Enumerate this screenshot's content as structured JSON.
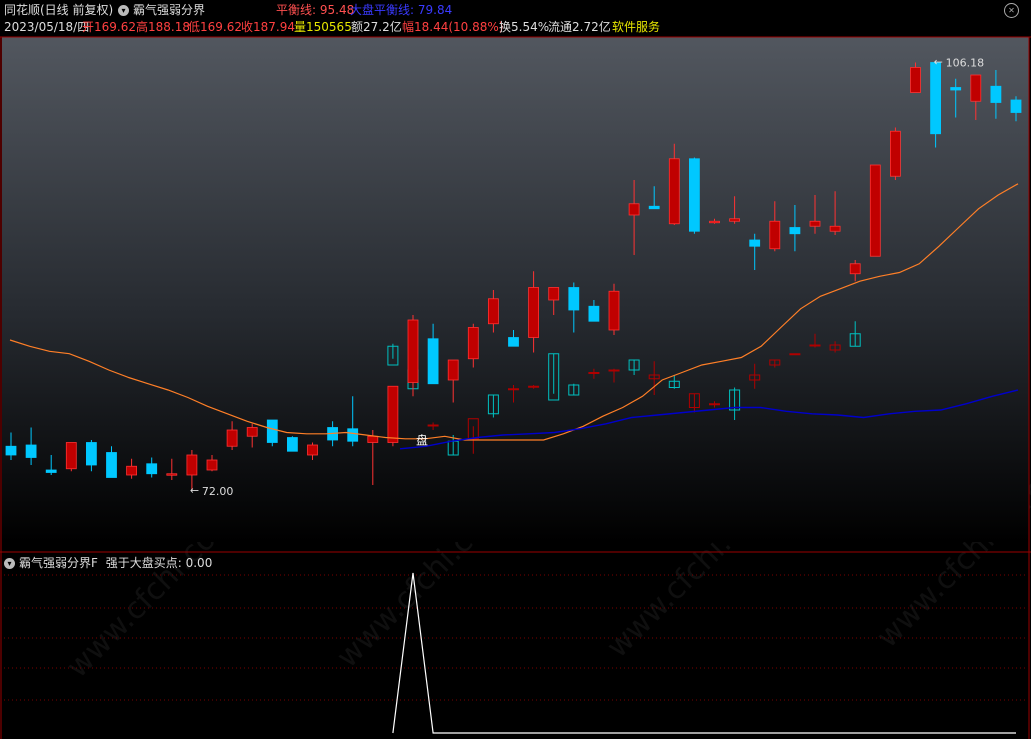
{
  "app": {
    "name": "同花顺(日线 前复权)",
    "indicator": "霸气强弱分界",
    "balance_label": "平衡线:",
    "balance_value": "95.48",
    "benchmark_label": "大盘平衡线:",
    "benchmark_value": "79.84"
  },
  "info": {
    "date": "2023/05/18/四",
    "open_label": "开",
    "open": "169.62",
    "high_label": "高",
    "high": "188.18",
    "low_label": "低",
    "low": "169.62",
    "close_label": "收",
    "close": "187.94",
    "vol_label": "量",
    "vol": "150565",
    "amount_label": "额",
    "amount": "27.2亿",
    "change_label": "幅",
    "change": "18.44(10.88%)",
    "turnover_label": "换",
    "turnover": "5.54%",
    "float_label": "流通",
    "float_cap": "2.72亿",
    "sector": "软件服务"
  },
  "colors": {
    "up": "#ff3232",
    "up_fill": "#c00000",
    "down": "#00c8ff",
    "ma_line": "#ff7f27",
    "index_line": "#0000cc",
    "index_up": "#b00000",
    "index_down": "#00c0c0",
    "border": "#9b0000"
  },
  "main_chart": {
    "max_label": "106.18",
    "min_label": "72.00",
    "marker": "盘"
  },
  "sub_chart": {
    "title": "霸气强弱分界F",
    "series_label": "强于大盘买点:",
    "series_value": "0.00"
  },
  "watermark": "www.cfchi.com",
  "chart_data": {
    "type": "candlestick",
    "y_range": [
      68,
      108
    ],
    "candles": [
      {
        "o": 75.5,
        "h": 76.6,
        "l": 74.4,
        "c": 74.8
      },
      {
        "o": 75.6,
        "h": 77.0,
        "l": 74.0,
        "c": 74.6
      },
      {
        "o": 73.6,
        "h": 74.8,
        "l": 73.2,
        "c": 73.4
      },
      {
        "o": 73.7,
        "h": 75.8,
        "l": 73.5,
        "c": 75.8
      },
      {
        "o": 75.8,
        "h": 76.0,
        "l": 73.5,
        "c": 74.0
      },
      {
        "o": 75.0,
        "h": 75.5,
        "l": 73.0,
        "c": 73.0
      },
      {
        "o": 73.2,
        "h": 74.5,
        "l": 72.9,
        "c": 73.9
      },
      {
        "o": 74.1,
        "h": 74.6,
        "l": 73.0,
        "c": 73.3
      },
      {
        "o": 73.3,
        "h": 74.5,
        "l": 72.8,
        "c": 73.3
      },
      {
        "o": 73.2,
        "h": 75.2,
        "l": 72.0,
        "c": 74.8
      },
      {
        "o": 73.6,
        "h": 74.8,
        "l": 73.5,
        "c": 74.4
      },
      {
        "o": 75.5,
        "h": 77.5,
        "l": 75.2,
        "c": 76.8
      },
      {
        "o": 76.3,
        "h": 77.3,
        "l": 75.4,
        "c": 77.0
      },
      {
        "o": 77.6,
        "h": 77.6,
        "l": 75.5,
        "c": 75.8
      },
      {
        "o": 76.2,
        "h": 76.3,
        "l": 75.1,
        "c": 75.1
      },
      {
        "o": 74.8,
        "h": 75.8,
        "l": 74.4,
        "c": 75.6
      },
      {
        "o": 77.0,
        "h": 77.5,
        "l": 75.5,
        "c": 76.0
      },
      {
        "o": 76.9,
        "h": 79.5,
        "l": 75.5,
        "c": 75.9
      },
      {
        "o": 75.8,
        "h": 76.8,
        "l": 72.4,
        "c": 76.3
      },
      {
        "o": 75.8,
        "h": 79.5,
        "l": 75.5,
        "c": 80.3
      },
      {
        "o": 80.6,
        "h": 86.0,
        "l": 79.5,
        "c": 85.6
      },
      {
        "o": 84.1,
        "h": 85.3,
        "l": 80.5,
        "c": 80.5
      },
      {
        "o": 80.8,
        "h": 82.4,
        "l": 79.0,
        "c": 82.4
      },
      {
        "o": 82.5,
        "h": 85.3,
        "l": 81.8,
        "c": 85.0
      },
      {
        "o": 85.3,
        "h": 88.0,
        "l": 84.6,
        "c": 87.3
      },
      {
        "o": 84.2,
        "h": 84.8,
        "l": 83.5,
        "c": 83.5
      },
      {
        "o": 84.2,
        "h": 89.5,
        "l": 83.0,
        "c": 88.2
      },
      {
        "o": 87.2,
        "h": 88.2,
        "l": 86.0,
        "c": 88.2
      },
      {
        "o": 88.2,
        "h": 88.6,
        "l": 84.6,
        "c": 86.4
      },
      {
        "o": 86.7,
        "h": 87.2,
        "l": 85.5,
        "c": 85.5
      },
      {
        "o": 84.8,
        "h": 88.5,
        "l": 84.4,
        "c": 87.9
      },
      {
        "o": 94.0,
        "h": 96.8,
        "l": 90.8,
        "c": 94.9
      },
      {
        "o": 94.7,
        "h": 96.3,
        "l": 94.6,
        "c": 94.5
      },
      {
        "o": 93.3,
        "h": 99.7,
        "l": 93.2,
        "c": 98.5
      },
      {
        "o": 98.5,
        "h": 98.6,
        "l": 92.5,
        "c": 92.7
      },
      {
        "o": 93.5,
        "h": 93.7,
        "l": 93.3,
        "c": 93.5
      },
      {
        "o": 93.5,
        "h": 95.5,
        "l": 93.3,
        "c": 93.7
      },
      {
        "o": 92.0,
        "h": 92.5,
        "l": 89.6,
        "c": 91.5
      },
      {
        "o": 91.3,
        "h": 95.1,
        "l": 91.1,
        "c": 93.5
      },
      {
        "o": 93.0,
        "h": 94.8,
        "l": 91.1,
        "c": 92.5
      },
      {
        "o": 93.1,
        "h": 95.6,
        "l": 92.5,
        "c": 93.5
      },
      {
        "o": 92.7,
        "h": 95.9,
        "l": 92.4,
        "c": 93.1
      },
      {
        "o": 89.3,
        "h": 90.4,
        "l": 88.7,
        "c": 90.1
      },
      {
        "o": 90.7,
        "h": 98.0,
        "l": 90.7,
        "c": 98.0
      },
      {
        "o": 97.1,
        "h": 101.0,
        "l": 96.8,
        "c": 100.7
      },
      {
        "o": 103.8,
        "h": 106.2,
        "l": 103.8,
        "c": 105.8
      },
      {
        "o": 106.2,
        "h": 106.3,
        "l": 99.4,
        "c": 100.5
      },
      {
        "o": 104.2,
        "h": 104.9,
        "l": 101.8,
        "c": 104.0
      },
      {
        "o": 103.1,
        "h": 104.9,
        "l": 101.6,
        "c": 105.2
      },
      {
        "o": 104.3,
        "h": 105.6,
        "l": 101.7,
        "c": 103.0
      },
      {
        "o": 103.2,
        "h": 103.5,
        "l": 101.5,
        "c": 102.2
      }
    ],
    "index_candles": [
      {
        "o": 83.5,
        "h": 83.7,
        "l": 82.5,
        "c": 82.0
      },
      {
        "o": 81.6,
        "h": 82.9,
        "l": 80.3,
        "c": 80.1
      },
      {
        "o": 77.2,
        "h": 77.4,
        "l": 76.8,
        "c": 77.2
      },
      {
        "o": 75.9,
        "h": 76.4,
        "l": 74.8,
        "c": 74.8
      },
      {
        "o": 76.1,
        "h": 77.1,
        "l": 74.9,
        "c": 77.7
      },
      {
        "o": 79.6,
        "h": 79.6,
        "l": 77.8,
        "c": 78.1
      },
      {
        "o": 80.1,
        "h": 80.4,
        "l": 79.0,
        "c": 80.1
      },
      {
        "o": 80.3,
        "h": 80.4,
        "l": 80.1,
        "c": 80.3
      },
      {
        "o": 82.9,
        "h": 82.9,
        "l": 79.7,
        "c": 79.2
      },
      {
        "o": 80.4,
        "h": 80.5,
        "l": 79.6,
        "c": 79.6
      },
      {
        "o": 81.4,
        "h": 81.7,
        "l": 80.9,
        "c": 81.4
      },
      {
        "o": 81.6,
        "h": 81.7,
        "l": 80.6,
        "c": 81.6
      },
      {
        "o": 82.4,
        "h": 82.4,
        "l": 81.2,
        "c": 81.6
      },
      {
        "o": 80.9,
        "h": 82.3,
        "l": 79.6,
        "c": 81.2
      },
      {
        "o": 80.7,
        "h": 81.2,
        "l": 80.1,
        "c": 80.2
      },
      {
        "o": 78.6,
        "h": 79.7,
        "l": 78.2,
        "c": 79.7
      },
      {
        "o": 78.9,
        "h": 79.1,
        "l": 78.6,
        "c": 78.9
      },
      {
        "o": 80.0,
        "h": 80.2,
        "l": 77.6,
        "c": 78.4
      },
      {
        "o": 80.8,
        "h": 82.1,
        "l": 80.1,
        "c": 81.2
      },
      {
        "o": 82.0,
        "h": 82.4,
        "l": 81.8,
        "c": 82.4
      },
      {
        "o": 82.9,
        "h": 82.9,
        "l": 82.9,
        "c": 82.9
      },
      {
        "o": 83.6,
        "h": 84.5,
        "l": 83.4,
        "c": 83.6
      },
      {
        "o": 83.2,
        "h": 83.9,
        "l": 83.0,
        "c": 83.6
      },
      {
        "o": 84.5,
        "h": 85.5,
        "l": 83.5,
        "c": 83.5
      }
    ],
    "ma": [
      84.0,
      83.5,
      83.1,
      82.9,
      82.3,
      81.6,
      81.0,
      80.5,
      80.0,
      79.4,
      78.7,
      78.1,
      77.5,
      77.0,
      76.6,
      76.5,
      76.5,
      76.6,
      76.4,
      76.2,
      76.1,
      76.1,
      76.3,
      76.0,
      76.0,
      76.0,
      76.0,
      76.0,
      76.5,
      77.1,
      77.9,
      78.6,
      79.5,
      80.8,
      81.4,
      82.0,
      82.3,
      82.6,
      83.5,
      85.0,
      86.5,
      87.5,
      88.1,
      88.7,
      89.1,
      89.4,
      90.1,
      91.5,
      93.0,
      94.5,
      95.6,
      96.5
    ],
    "index_ma": [
      75.3,
      75.5,
      75.9,
      76.2,
      76.4,
      76.5,
      76.6,
      76.9,
      77.3,
      77.8,
      78.0,
      78.2,
      78.4,
      78.6,
      78.6,
      78.3,
      78.1,
      78.0,
      77.8,
      78.1,
      78.3,
      78.4,
      78.9,
      79.5,
      80.0
    ],
    "sub_series": [
      0,
      0,
      0,
      0,
      0,
      0,
      0,
      0,
      0,
      0,
      0,
      0,
      0,
      0,
      0,
      0,
      0,
      0,
      0,
      0,
      1,
      0,
      0,
      0,
      0,
      0,
      0,
      0,
      0,
      0,
      0,
      0,
      0,
      0,
      0,
      0,
      0,
      0,
      0,
      0,
      0,
      0,
      0,
      0,
      0,
      0,
      0,
      0,
      0,
      0,
      0
    ]
  }
}
